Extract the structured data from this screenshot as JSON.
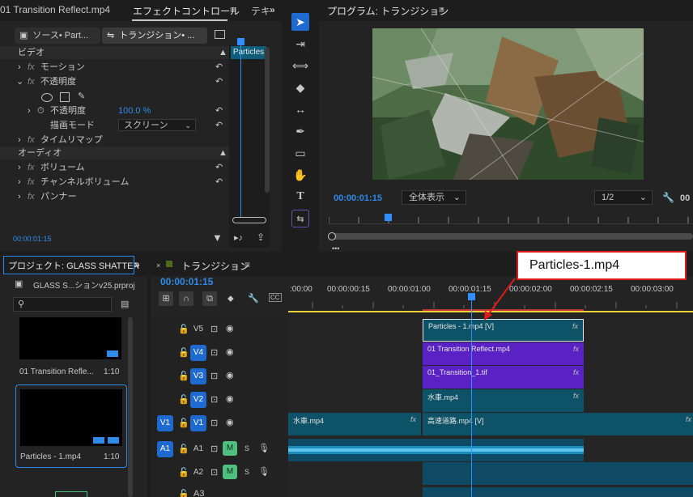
{
  "effect_panel": {
    "source_tab": "01 Transition Reflect.mp4",
    "effect_controls_tab": "エフェクトコントロール",
    "text_tab": "テキ",
    "menu_icon": "menu-icon",
    "source_button": "ソース• Part...",
    "seq_button": "トランジション• ...",
    "clip_label": "Particles",
    "video_header": "ビデオ",
    "motion": "モーション",
    "opacity": "不透明度",
    "opacity_sub": "不透明度",
    "opacity_value": "100.0 %",
    "blend_mode_label": "描画モード",
    "blend_mode_value": "スクリーン",
    "time_remap": "タイムリマップ",
    "audio_header": "オーディオ",
    "volume": "ボリューム",
    "channel_volume": "チャンネルボリューム",
    "panner": "パンナー",
    "timecode": "00:00:01:15"
  },
  "program_monitor": {
    "title": "プログラム: トランジション",
    "timecode": "00:00:01:15",
    "fit_select": "全体表示",
    "res_select": "1/2",
    "right_timecode": "00"
  },
  "project_panel": {
    "title": "プロジェクト: GLASS SHATTER",
    "project_file": "GLASS S...ションv25.prproj",
    "items": [
      {
        "name": "01 Transition Refle...",
        "duration": "1:10"
      },
      {
        "name": "Particles - 1.mp4",
        "duration": "1:10"
      }
    ]
  },
  "timeline": {
    "title": "トランジション",
    "timecode": "00:00:01:15",
    "ruler": [
      ":00:00",
      "00:00:00:15",
      "00:00:01:00",
      "00:00:01:15",
      "00:00:02:00",
      "00:00:02:15",
      "00:00:03:00"
    ],
    "tracks": [
      {
        "name": "V5",
        "on": false
      },
      {
        "name": "V4",
        "on": true
      },
      {
        "name": "V3",
        "on": true
      },
      {
        "name": "V2",
        "on": true
      },
      {
        "name": "V1",
        "on": true
      },
      {
        "name": "A1",
        "on": false
      },
      {
        "name": "A2",
        "on": false
      },
      {
        "name": "A3",
        "on": false
      }
    ],
    "v1_source": "V1",
    "a1_source": "A1",
    "mute": "M",
    "solo": "S",
    "fx": "fx",
    "clips": {
      "v5": "Particles - 1.mp4 [V]",
      "v4": "01 Transition Reflect.mp4",
      "v3": "01_Transition_1.tif",
      "v2": "水車.mp4",
      "v1a": "水車.mp4",
      "v1b": "高速道路.mp4 [V]"
    }
  },
  "annotation": {
    "label": "Particles-1.mp4",
    "color": "#e01b1b"
  },
  "colors": {
    "accent": "#2d8ceb",
    "clip_teal": "#0d5266",
    "clip_purple": "#5a22c4",
    "playhead": "#2f8fff",
    "audio": "#1a8dbd"
  }
}
